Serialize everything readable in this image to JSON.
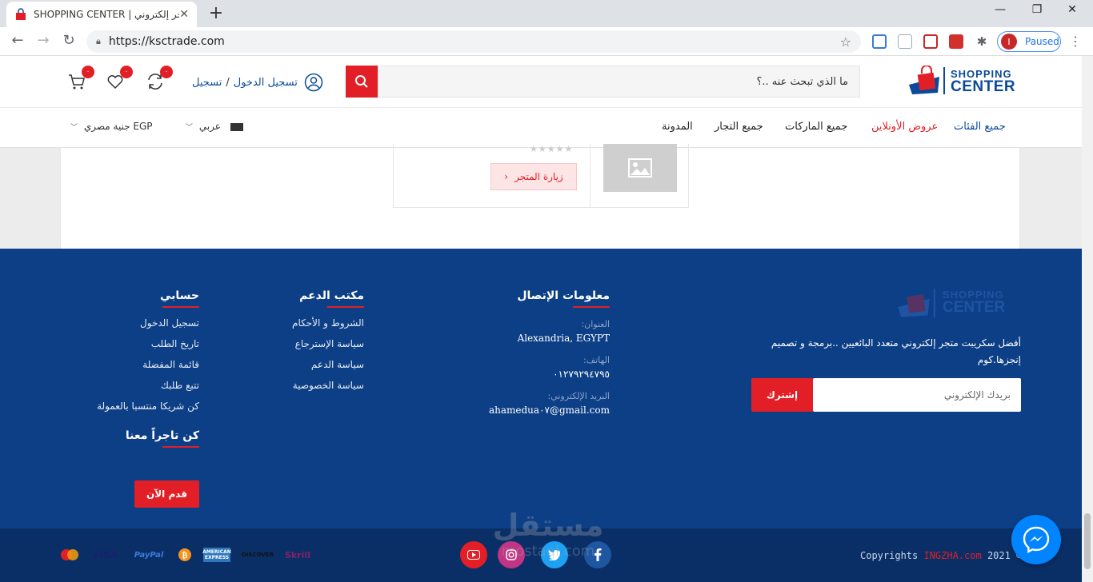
{
  "browser": {
    "tab_title": "SHOPPING CENTER | متجر إلكتروني",
    "url": "https://ksctrade.com",
    "profile_status": "Paused",
    "profile_initial": "I"
  },
  "header": {
    "logo_line1": "SHOPPING",
    "logo_line2": "CENTER",
    "search_placeholder": "ما الذي تبحث عنه ..؟",
    "login_label": "تسجيل الدخول",
    "separator": "/",
    "register_label": "تسجيل",
    "compare_count": "٠",
    "wishlist_count": "٠",
    "cart_count": "٠"
  },
  "nav": {
    "items": [
      "جميع الفئات",
      "عروض الأونلاين",
      "جميع الماركات",
      "جميع التجار",
      "المدونة"
    ],
    "language": "عربي",
    "currency": "جنية مصري EGP"
  },
  "store_card": {
    "stars": "★★★★★",
    "visit_label": "زيارة المتجر"
  },
  "footer": {
    "logo_line1": "SHOPPING",
    "logo_line2": "CENTER",
    "description": "أفضل سكريبت متجر إلكتروني متعدد البائعيين ..برمجة و تصميم إنجزها.كوم",
    "email_placeholder": "بريدك الإلكتروني",
    "subscribe_label": "إشترك",
    "contact": {
      "heading": "معلومات الإتصال",
      "address_label": "العنوان:",
      "address_value": "Alexandria, EGYPT",
      "phone_label": "الهاتف:",
      "phone_value": "٠١٢٧٩٢٩٤٧٩٥",
      "email_label": "البريد الإلكتروني:",
      "email_value": "ahamedua٠٧@gmail.com"
    },
    "support": {
      "heading": "مكتب الدعم",
      "links": [
        "الشروط و الأحكام",
        "سياسة الإسترجاع",
        "سياسة الدعم",
        "سياسة الخصوصية"
      ]
    },
    "account": {
      "heading": "حسابي",
      "links": [
        "تسجيل الدخول",
        "تاريخ الطلب",
        "قائمة المفضلة",
        "تتبع طلبك",
        "كن شريكا منتسبا بالعمولة"
      ]
    },
    "merchant": {
      "heading": "كن تاجراً معنا",
      "button_label": "قدم الآن"
    }
  },
  "bottom": {
    "payments": [
      "MasterCard",
      "VISA",
      "PayPal",
      "Bitcoin",
      "AMERICAN EXPRESS",
      "DISCOVER",
      "Skrill"
    ],
    "copyright_prefix": "Copyrights ",
    "copyright_brand": "INGZHA.com",
    "copyright_year": " 2021 ©",
    "watermark_line1": "مستقل",
    "watermark_line2": "mostaql.com"
  },
  "colors": {
    "brand_blue": "#0b4a9a",
    "brand_red": "#e21f26",
    "footer_bg": "#0d3f86",
    "bottom_bg": "#0a2f66"
  }
}
